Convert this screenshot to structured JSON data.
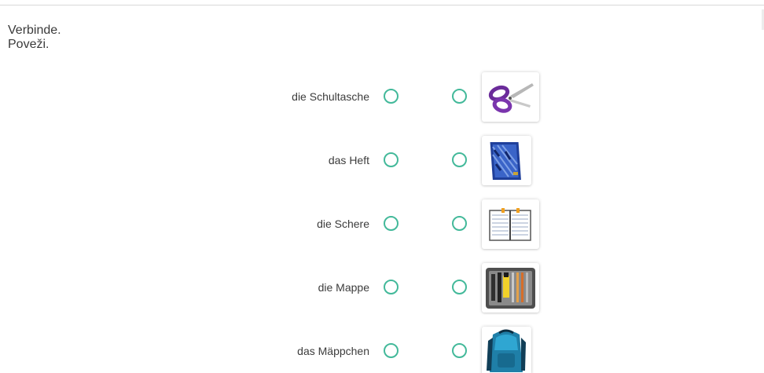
{
  "instructions": {
    "line1": "Verbinde.",
    "line2": "Poveži."
  },
  "rows": [
    {
      "label": "die Schultasche",
      "image_icon": "scissors-icon"
    },
    {
      "label": "das Heft",
      "image_icon": "notebook-icon"
    },
    {
      "label": "die Schere",
      "image_icon": "ring-binder-icon"
    },
    {
      "label": "die Mappe",
      "image_icon": "pencil-case-icon"
    },
    {
      "label": "das Mäppchen",
      "image_icon": "backpack-icon"
    }
  ],
  "colors": {
    "radio_border": "#43b99a",
    "text": "#3c3c3c",
    "rule": "#d9d9d9"
  }
}
